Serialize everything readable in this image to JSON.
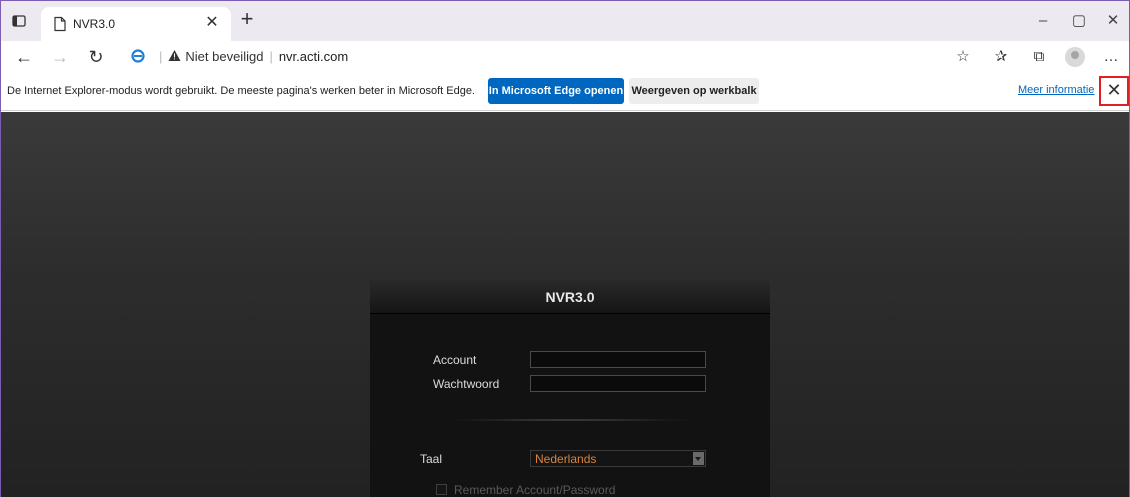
{
  "browser": {
    "tab": {
      "title": "NVR3.0"
    },
    "address": {
      "security_text": "Niet beveiligd",
      "url": "nvr.acti.com"
    },
    "infobar": {
      "message": "De Internet Explorer-modus wordt gebruikt. De meeste pagina's werken beter in Microsoft Edge.",
      "open_edge_label": "In Microsoft Edge openen",
      "show_toolbar_label": "Weergeven op werkbalk",
      "more_info_label": "Meer informatie"
    },
    "colors": {
      "accent": "#0067c0",
      "highlight_border": "#e02020",
      "frame": "#7a5cb0"
    }
  },
  "login": {
    "title": "NVR3.0",
    "account_label": "Account",
    "account_value": "",
    "password_label": "Wachtwoord",
    "password_value": "",
    "language_label": "Taal",
    "language_value": "Nederlands",
    "remember_label": "Remember Account/Password",
    "language_color": "#d9843e"
  }
}
